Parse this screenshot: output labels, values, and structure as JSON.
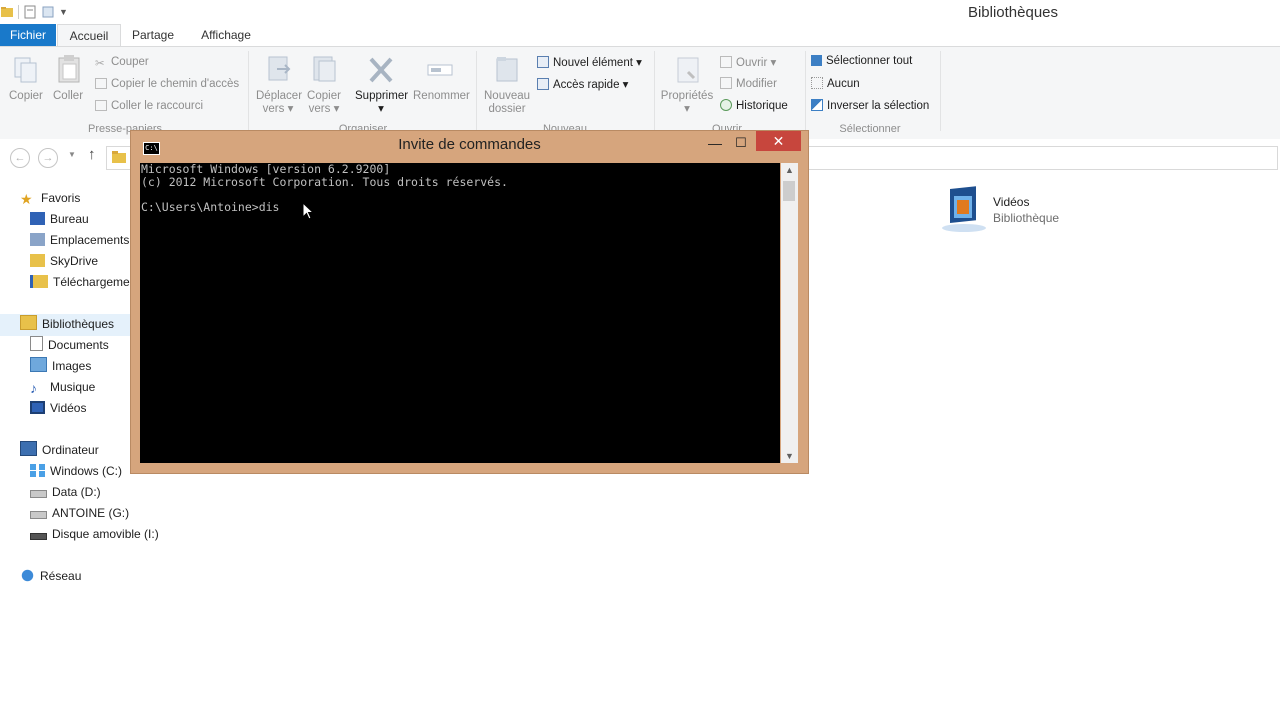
{
  "window": {
    "title": "Bibliothèques"
  },
  "tabs": {
    "fichier": "Fichier",
    "accueil": "Accueil",
    "partage": "Partage",
    "affichage": "Affichage"
  },
  "ribbon": {
    "presse_papiers": {
      "copier": "Copier",
      "coller": "Coller",
      "couper": "Couper",
      "copier_chemin": "Copier le chemin d'accès",
      "coller_raccourci": "Coller le raccourci",
      "group_label": "Presse-papiers"
    },
    "organiser": {
      "deplacer_1": "Déplacer",
      "deplacer_2": "vers",
      "copier_1": "Copier",
      "copier_2": "vers",
      "supprimer": "Supprimer",
      "renommer": "Renommer",
      "group_label": "Organiser"
    },
    "nouveau": {
      "dossier_1": "Nouveau",
      "dossier_2": "dossier",
      "nouvel_element": "Nouvel élément",
      "acces_rapide": "Accès rapide",
      "group_label": "Nouveau"
    },
    "ouvrir": {
      "proprietes": "Propriétés",
      "ouvrir": "Ouvrir",
      "modifier": "Modifier",
      "historique": "Historique",
      "group_label": "Ouvrir"
    },
    "selectionner": {
      "tout": "Sélectionner tout",
      "aucun": "Aucun",
      "inverser": "Inverser la sélection",
      "group_label": "Sélectionner"
    }
  },
  "nav": {
    "favoris": "Favoris",
    "bureau": "Bureau",
    "emplacements": "Emplacements",
    "skydrive": "SkyDrive",
    "telechargements": "Téléchargemen",
    "bibliotheques": "Bibliothèques",
    "documents": "Documents",
    "images": "Images",
    "musique": "Musique",
    "videos": "Vidéos",
    "ordinateur": "Ordinateur",
    "windows_c": "Windows (C:)",
    "data_d": "Data (D:)",
    "antoine_g": "ANTOINE (G:)",
    "disque_i": "Disque amovible (I:)",
    "reseau": "Réseau"
  },
  "content": {
    "videos_name": "Vidéos",
    "videos_type": "Bibliothèque"
  },
  "cmd": {
    "title": "Invite de commandes",
    "icon_text": "C:\\",
    "lines": [
      "Microsoft Windows [version 6.2.9200]",
      "(c) 2012 Microsoft Corporation. Tous droits réservés.",
      "",
      "C:\\Users\\Antoine>dis"
    ]
  },
  "colors": {
    "cmd_frame": "#d6a57d",
    "tab_fichier": "#1979ca",
    "close_button": "#c7463d",
    "selection": "#e5f1fb"
  }
}
